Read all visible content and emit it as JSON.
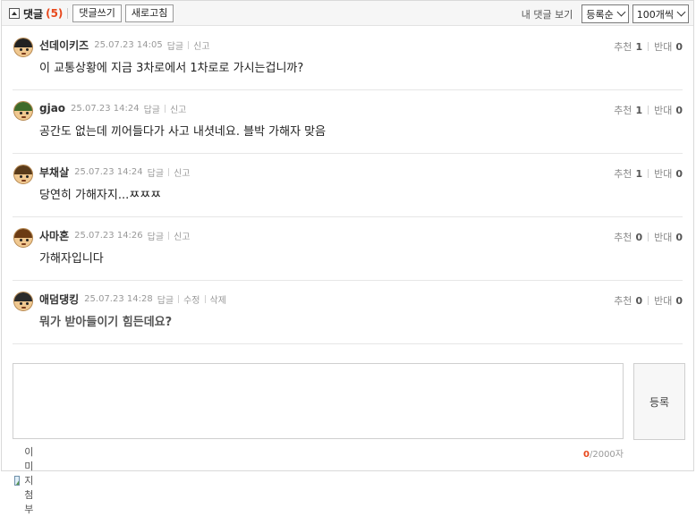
{
  "header": {
    "title": "댓글",
    "count": "(5)",
    "write_button": "댓글쓰기",
    "refresh_button": "새로고침",
    "my_comments_link": "내 댓글 보기",
    "sort_select": "등록순",
    "per_page_select": "100개씩"
  },
  "vote_labels": {
    "up": "추천",
    "down": "반대"
  },
  "comments": [
    {
      "nickname": "선데이키즈",
      "date": "25.07.23 14:05",
      "actions": [
        "답글",
        "신고"
      ],
      "text": "이 교통상황에 지금 3차로에서 1차로로 가시는겁니까?",
      "up": "1",
      "down": "0",
      "bold": false
    },
    {
      "nickname": "gjao",
      "date": "25.07.23 14:24",
      "actions": [
        "답글",
        "신고"
      ],
      "text": "공간도 없는데 끼어들다가 사고 내셧네요. 블박 가해자 맞음",
      "up": "1",
      "down": "0",
      "bold": false
    },
    {
      "nickname": "부채살",
      "date": "25.07.23 14:24",
      "actions": [
        "답글",
        "신고"
      ],
      "text": "당연히 가해자지...ㅉㅉㅉ",
      "up": "1",
      "down": "0",
      "bold": false
    },
    {
      "nickname": "사마혼",
      "date": "25.07.23 14:26",
      "actions": [
        "답글",
        "신고"
      ],
      "text": "가해자입니다",
      "up": "0",
      "down": "0",
      "bold": false
    },
    {
      "nickname": "애덤댕킹",
      "date": "25.07.23 14:28",
      "actions": [
        "답글",
        "수정",
        "삭제"
      ],
      "text": "뭐가 받아들이기 힘든데요?",
      "up": "0",
      "down": "0",
      "bold": true
    }
  ],
  "write": {
    "submit_button": "등록",
    "attach_label": "이미지첨부",
    "char_current": "0",
    "char_max": "/2000자"
  },
  "colors": {
    "accent": "#e8481c"
  }
}
